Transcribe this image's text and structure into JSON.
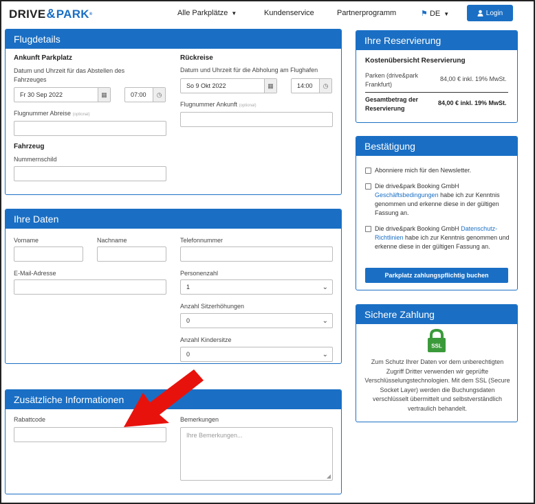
{
  "nav": {
    "logo_drive": "DRIVE",
    "logo_mark": "&",
    "logo_park": "PARK",
    "logo_reg": "®",
    "all_parking": "Alle Parkplätze",
    "customer_service": "Kundenservice",
    "partner_program": "Partnerprogramm",
    "language": "DE",
    "login": "Login"
  },
  "flight": {
    "header": "Flugdetails",
    "arrival_title": "Ankunft Parkplatz",
    "arrival_label": "Datum und Uhrzeit für das Abstellen des Fahrzeuges",
    "arrival_date": "Fr 30 Sep 2022",
    "arrival_time": "07:00",
    "return_title": "Rückreise",
    "return_label": "Datum und Uhrzeit für die Abholung am Flughafen",
    "return_date": "So 9 Okt 2022",
    "return_time": "14:00",
    "flight_out_label": "Flugnummer Abreise",
    "flight_in_label": "Flugnummer Ankunft",
    "optional": "(optional)",
    "vehicle_title": "Fahrzeug",
    "plate_label": "Nummernschild"
  },
  "personal": {
    "header": "Ihre Daten",
    "firstname_label": "Vorname",
    "lastname_label": "Nachname",
    "phone_label": "Telefonnummer",
    "email_label": "E-Mail-Adresse",
    "persons_label": "Personenzahl",
    "persons_value": "1",
    "boosters_label": "Anzahl Sitzerhöhungen",
    "boosters_value": "0",
    "childseats_label": "Anzahl Kindersitze",
    "childseats_value": "0"
  },
  "extra": {
    "header": "Zusätzliche Informationen",
    "discount_label": "Rabattcode",
    "notes_label": "Bemerkungen",
    "notes_placeholder": "Ihre Bemerkungen..."
  },
  "reservation": {
    "header": "Ihre Reservierung",
    "title": "Kostenübersicht Reservierung",
    "row1_label": "Parken (drive&park Frankfurt)",
    "row1_value": "84,00 € inkl. 19% MwSt.",
    "total_label": "Gesamtbetrag der Reservierung",
    "total_value": "84,00 € inkl. 19% MwSt."
  },
  "confirmation": {
    "header": "Bestätigung",
    "newsletter": "Abonniere mich für den Newsletter.",
    "terms_pre": "Die drive&park Booking GmbH",
    "terms_link": "Geschäftsbedingungen",
    "terms_post": "habe ich zur Kenntnis genommen und erkenne diese in der gültigen Fassung an.",
    "privacy_pre": "Die drive&park Booking GmbH",
    "privacy_link": "Datenschutz-Richtlinien",
    "privacy_post": "habe ich zur Kenntnis genommen und erkenne diese in der gültigen Fassung an.",
    "book_button": "Parkplatz zahlungspflichtig buchen"
  },
  "payment": {
    "header": "Sichere Zahlung",
    "ssl_label": "SSL",
    "text": "Zum Schutz Ihrer Daten vor dem unberechtigten Zugriff Dritter verwenden wir geprüfte Verschlüsselungstechnologien. Mit dem SSL (Secure Socket Layer) werden die Buchungsdaten verschlüsselt übermittelt und selbstverständlich vertraulich behandelt."
  },
  "icons": {
    "calendar": "calendar-icon",
    "clock": "clock-icon",
    "user": "user-icon",
    "flag": "flag-icon",
    "lock": "ssl-lock-icon",
    "arrow": "red-arrow-annotation"
  },
  "colors": {
    "primary": "#1a6fc4",
    "ssl_green": "#3a9a3a",
    "annotation_red": "#e8120c"
  }
}
